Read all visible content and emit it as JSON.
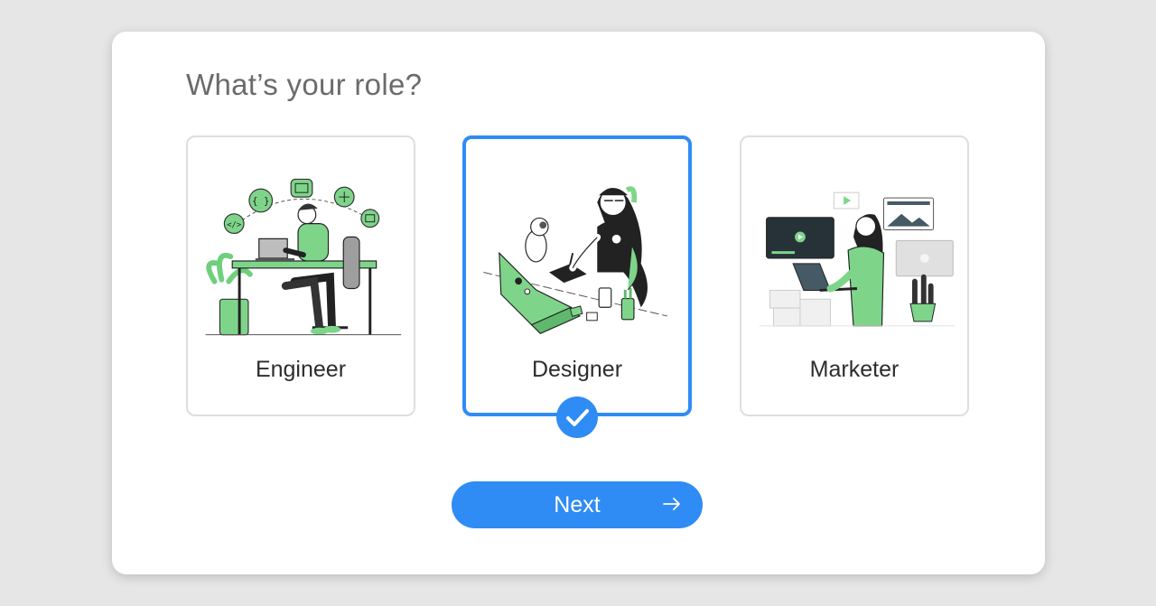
{
  "dialog": {
    "title": "What’s your role?"
  },
  "roles": [
    {
      "label": "Engineer",
      "selected": false,
      "illustration": "engineer-at-desk-illustration"
    },
    {
      "label": "Designer",
      "selected": true,
      "illustration": "designer-with-cat-illustration"
    },
    {
      "label": "Marketer",
      "selected": false,
      "illustration": "marketer-with-laptop-illustration"
    }
  ],
  "actions": {
    "next_label": "Next",
    "next_icon": "arrow-right-icon",
    "selected_icon": "checkmark-icon"
  },
  "colors": {
    "accent": "#2f8cf4",
    "illustration_green": "#7ed58a",
    "background": "#e6e6e6"
  }
}
